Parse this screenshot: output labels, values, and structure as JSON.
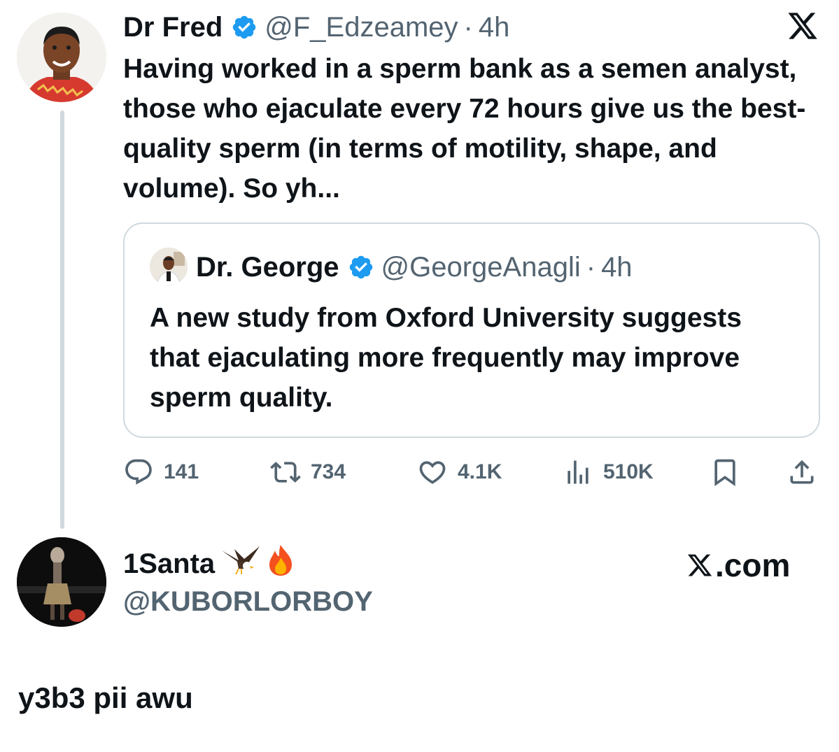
{
  "tweet": {
    "author_name": "Dr Fred",
    "author_handle": "@F_Edzeamey",
    "separator": "·",
    "time": "4h",
    "text": "Having worked in a sperm bank as a semen analyst, those who ejaculate every 72 hours give us the best-quality sperm (in terms of motility, shape, and volume). So yh...",
    "logo": "x-logo-icon"
  },
  "quoted": {
    "author_name": "Dr. George",
    "author_handle": "@GeorgeAnagli",
    "separator": "·",
    "time": "4h",
    "text": "A new study from Oxford University suggests that ejaculating more frequently may improve sperm quality."
  },
  "actions": {
    "replies": "141",
    "reposts": "734",
    "likes": "4.1K",
    "views": "510K",
    "icons": [
      "reply-icon",
      "repost-icon",
      "like-icon",
      "views-icon",
      "bookmark-icon",
      "share-icon"
    ]
  },
  "reply": {
    "author_name": "1Santa",
    "emojis": [
      "eagle-emoji",
      "fire-emoji"
    ],
    "author_handle": "@KUBORLORBOY",
    "source": ".com",
    "text": "y3b3 pii awu"
  },
  "colors": {
    "text": "#0f1419",
    "secondary": "#536471",
    "verified": "#1d9bf0",
    "border": "#cfd9de"
  }
}
